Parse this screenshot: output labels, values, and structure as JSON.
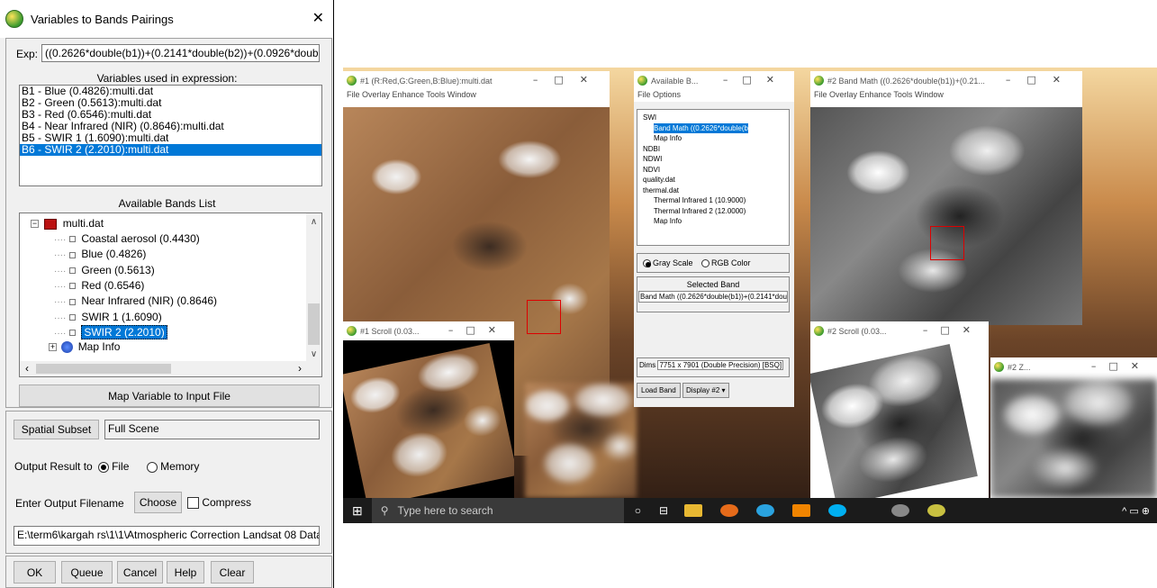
{
  "dialog": {
    "title": "Variables to Bands Pairings",
    "exp_label": "Exp:",
    "expression": "((0.2626*double(b1))+(0.2141*double(b2))+(0.0926*double(b",
    "variables_header": "Variables used in expression:",
    "variables": [
      "B1 - Blue (0.4826):multi.dat",
      "B2 - Green (0.5613):multi.dat",
      "B3 - Red (0.6546):multi.dat",
      "B4 - Near Infrared (NIR) (0.8646):multi.dat",
      "B5 - SWIR 1 (1.6090):multi.dat",
      "B6 - SWIR 2 (2.2010):multi.dat"
    ],
    "selected_variable": 5,
    "bands_header": "Available Bands List",
    "tree_root": "multi.dat",
    "bands": [
      "Coastal aerosol (0.4430)",
      "Blue (0.4826)",
      "Green (0.5613)",
      "Red (0.6546)",
      "Near Infrared (NIR) (0.8646)",
      "SWIR 1 (1.6090)",
      "SWIR 2 (2.2010)"
    ],
    "selected_band": 6,
    "map_info": "Map Info",
    "map_button": "Map Variable to Input File",
    "spatial_subset": "Spatial Subset",
    "full_scene": "Full Scene",
    "output_label": "Output Result to",
    "file_opt": "File",
    "memory_opt": "Memory",
    "filename_label": "Enter Output Filename",
    "choose": "Choose",
    "compress": "Compress",
    "filename": "E:\\term6\\kargah rs\\1\\1\\Atmospheric Correction Landsat 08 Data",
    "buttons": {
      "ok": "OK",
      "queue": "Queue",
      "cancel": "Cancel",
      "help": "Help",
      "clear": "Clear"
    }
  },
  "screen": {
    "win1": {
      "title": "#1 (R:Red,G:Green,B:Blue):multi.dat",
      "menu": "File  Overlay  Enhance  Tools  Window"
    },
    "avail": {
      "title": "Available B...",
      "menu": "File  Options",
      "tree": [
        "SWI",
        "Band Math ((0.2626*double(b",
        "Map Info",
        "NDBI",
        "NDWI",
        "NDVI",
        "quality.dat",
        "thermal.dat",
        "Thermal Infrared 1 (10.9000)",
        "Thermal Infrared 2 (12.0000)",
        "Map Info"
      ],
      "gray": "Gray Scale",
      "rgb": "RGB Color",
      "sel_header": "Selected Band",
      "sel_band": "Band Math ((0.2626*double(b1))+(0.2141*dou",
      "dims_label": "Dims",
      "dims": "7751 x 7901 (Double Precision) [BSQ]",
      "load": "Load Band",
      "display": "Display #2 ▾"
    },
    "win2": {
      "title": "#2 Band Math ((0.2626*double(b1))+(0.21...",
      "menu": "File  Overlay  Enhance  Tools  Window"
    },
    "scroll1": {
      "title": "#1 Scroll (0.03..."
    },
    "scroll2": {
      "title": "#2 Scroll (0.03..."
    },
    "zoom2": {
      "title": "#2 Z..."
    },
    "search": "Type here to search"
  }
}
